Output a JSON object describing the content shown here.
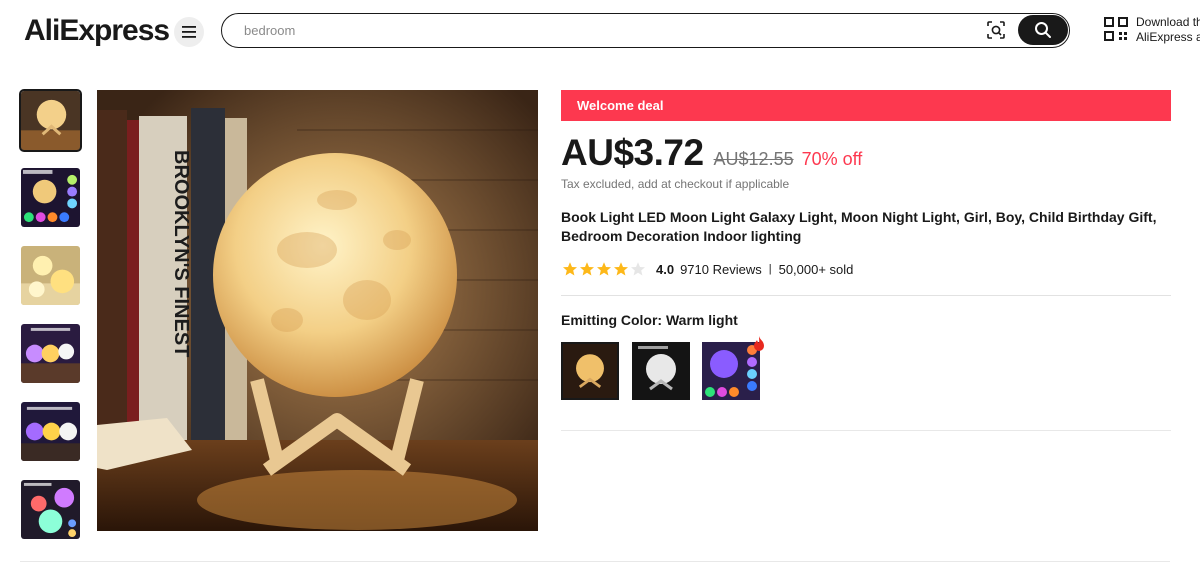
{
  "header": {
    "logo": "AliExpress",
    "search_placeholder": "bedroom",
    "download_line1": "Download th",
    "download_line2": "AliExpress a"
  },
  "product": {
    "deal_label": "Welcome deal",
    "price": "AU$3.72",
    "original_price": "AU$12.55",
    "discount": "70% off",
    "tax_note": "Tax excluded, add at checkout if applicable",
    "title": "Book Light LED Moon Light Galaxy Light, Moon Night Light, Girl, Boy, Child Birthday Gift, Bedroom Decoration Indoor lighting",
    "rating": "4.0",
    "rating_value": 4.0,
    "rating_max": 5,
    "reviews": "9710 Reviews",
    "sold": "50,000+ sold",
    "color_label": "Emitting Color: Warm light"
  },
  "main_image": {
    "book_spine_text": "BROOKLYN'S FINEST"
  },
  "thumbnails": [
    {
      "name": "thumb-warm-moon",
      "caption": ""
    },
    {
      "name": "thumb-night-light",
      "caption": "Moon Night Light"
    },
    {
      "name": "thumb-twin-moons",
      "caption": ""
    },
    {
      "name": "thumb-three-colors",
      "caption": "Three lighting modes"
    },
    {
      "name": "thumb-sixteen-colors",
      "caption": "16 RGB colors"
    },
    {
      "name": "thumb-moon-night-light",
      "caption": "Moon Night Light"
    }
  ],
  "swatches": [
    {
      "name": "warm-light",
      "selected": true
    },
    {
      "name": "white-light",
      "selected": false
    },
    {
      "name": "multicolor",
      "selected": false,
      "hot": true
    }
  ],
  "colors": {
    "deal_red": "#fd384f",
    "text": "#191919",
    "muted": "#757575",
    "star": "#fdb819"
  },
  "icons": {
    "menu": "menu-icon",
    "camera": "image-search-icon",
    "search": "search-icon",
    "qr": "qr-code-icon",
    "star": "star-icon",
    "hot": "flame-icon"
  }
}
